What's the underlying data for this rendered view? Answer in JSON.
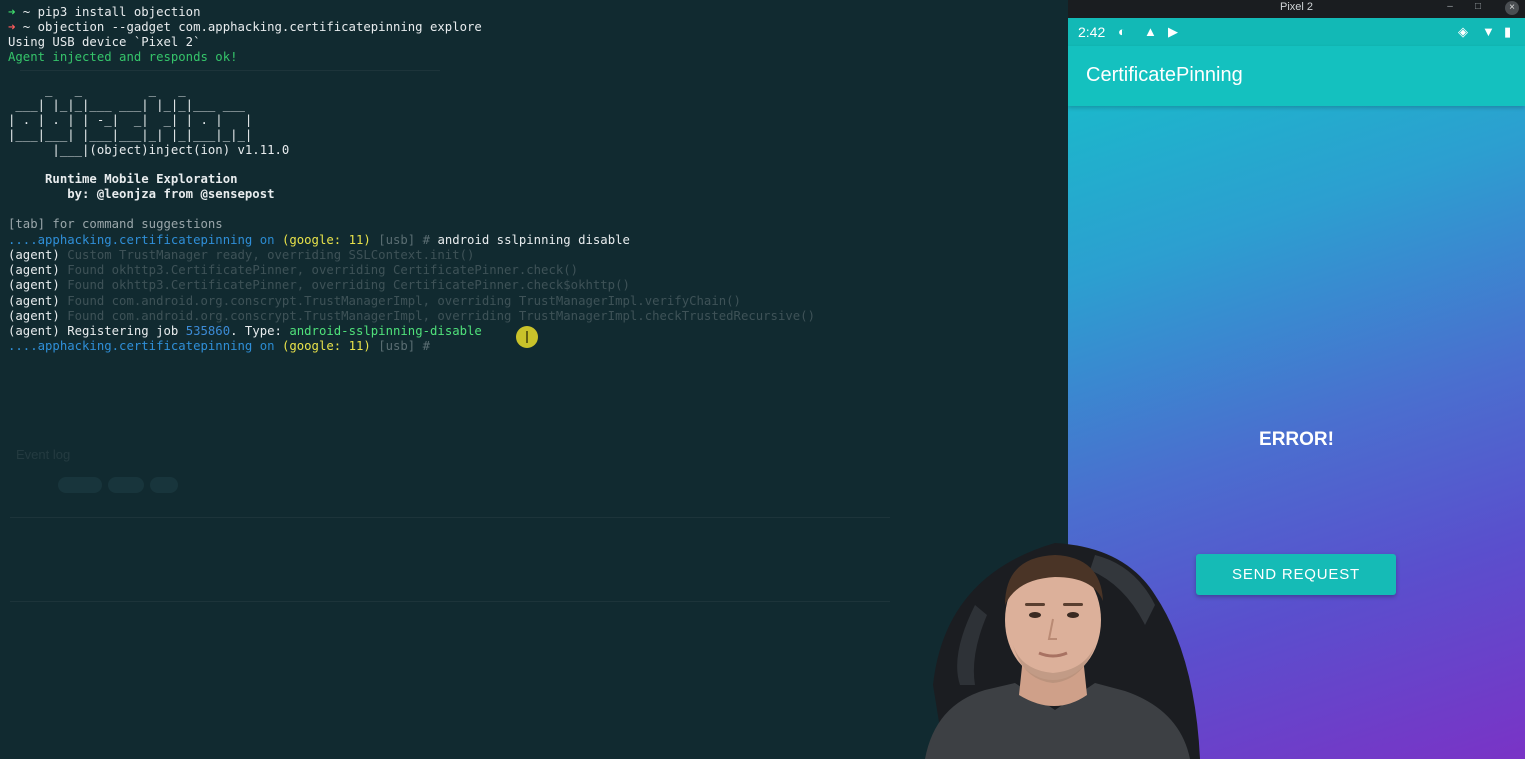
{
  "terminal": {
    "cmd1_prompt": "➜",
    "cmd1_text": " ~ pip3 install objection",
    "cmd2_prompt": "➜",
    "cmd2_text": " ~ objection --gadget com.apphacking.certificatepinning explore",
    "usb_line": "Using USB device `Pixel 2`",
    "agent_ok": "Agent injected and responds ok!",
    "ascii_art": "     _   _         _   _\n ___| |_|_|___ ___| |_|_|___ ___\n| . | . | | -_|  _|  _| | . |   |\n|___|___| |___|___|_| |_|___|_|_|\n      |___|(object)inject(ion) v1.11.0",
    "runtime": "     Runtime Mobile Exploration",
    "author": "        by: @leonjza from @sensepost",
    "tab_hint": "[tab] for command suggestions",
    "prompt_pkg": "....apphacking.certificatepinning",
    "prompt_on": "on",
    "prompt_device": "(google: 11)",
    "prompt_usb": "[usb]",
    "prompt_hash": "#",
    "command": "android sslpinning disable",
    "agent_lines": [
      {
        "prefix": "(agent) ",
        "text": "Custom TrustManager ready, overriding SSLContext.init()"
      },
      {
        "prefix": "(agent) ",
        "text": "Found okhttp3.CertificatePinner, overriding CertificatePinner.check()"
      },
      {
        "prefix": "(agent) ",
        "text": "Found okhttp3.CertificatePinner, overriding CertificatePinner.check$okhttp()"
      },
      {
        "prefix": "(agent) ",
        "text": "Found com.android.org.conscrypt.TrustManagerImpl, overriding TrustManagerImpl.verifyChain()"
      },
      {
        "prefix": "(agent) ",
        "text": "Found com.android.org.conscrypt.TrustManagerImpl, overriding TrustManagerImpl.checkTrustedRecursive()"
      }
    ],
    "register_prefix": "(agent) Registering job ",
    "job_id": "535860",
    "type_label": ". Type: ",
    "job_type": "android-sslpinning-disable",
    "ghost_event_log": "Event log"
  },
  "emulator": {
    "window_title": "Pixel 2",
    "time": "2:42",
    "app_title": "CertificatePinning",
    "error_text": "ERROR!",
    "send_button": "SEND REQUEST"
  },
  "colors": {
    "app_bar": "#14c1bf",
    "button": "#15bbb6",
    "terminal_bg": "#112a30"
  }
}
